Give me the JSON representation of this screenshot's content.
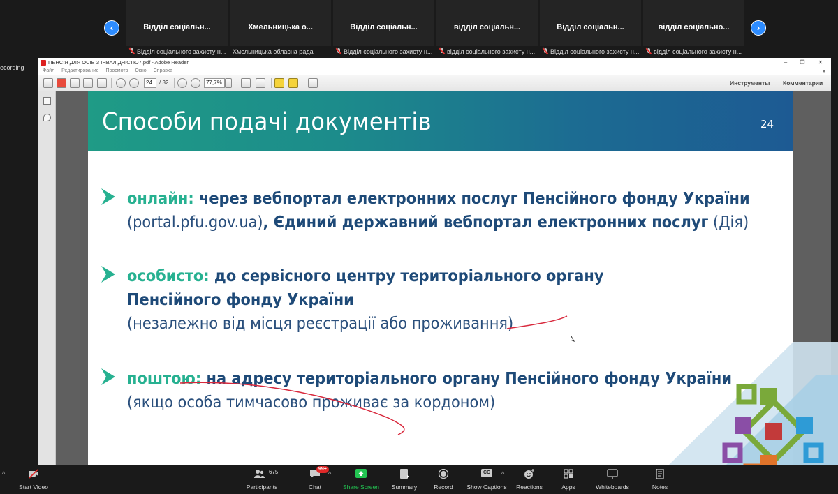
{
  "meeting": {
    "recording_label": "ecording",
    "participant_tiles": [
      {
        "name": "Відділ соціальн...",
        "label": "Відділ соціального захисту н...",
        "muted": true
      },
      {
        "name": "Хмельницька о...",
        "label": "Хмельницька обласна рада",
        "muted": false
      },
      {
        "name": "Відділ соціальн...",
        "label": "Відділ соціального захисту н...",
        "muted": true
      },
      {
        "name": "відділ соціальн...",
        "label": "відділ соціального захисту н...",
        "muted": true
      },
      {
        "name": "Відділ соціальн...",
        "label": "Відділ соціального захисту н...",
        "muted": true
      },
      {
        "name": "відділ соціально...",
        "label": "відділ соціального захисту н...",
        "muted": true
      }
    ],
    "prev_arrow": "‹",
    "next_arrow": "›"
  },
  "reader": {
    "window_title": "ПЕНСІЯ ДЛЯ ОСІБ З ІНВАЛІДНІСТЮ7.pdf - Adobe Reader",
    "window_buttons": {
      "minimize": "–",
      "restore": "❐",
      "close": "✕",
      "menu_close": "×"
    },
    "menu": [
      "Файл",
      "Редактирование",
      "Просмотр",
      "Окно",
      "Справка"
    ],
    "page_current": "24",
    "page_total": "/ 32",
    "zoom": "77,7%",
    "tools_label": "Инструменты",
    "comments_label": "Комментарии"
  },
  "slide": {
    "title": "Способи подачі документів",
    "page_number": "24",
    "bullets": [
      {
        "keyword": "онлайн:",
        "line1": " через вебпортал електронних послуг Пенсійного фонду України",
        "line2_light_a": "(portal.pfu.gov.ua)",
        "line2_bold": ", Єдиний державний вебпортал електронних послуг",
        "line2_light_b": " (Дія)"
      },
      {
        "keyword": "особисто:",
        "line1": " до сервісного центру територіального органу",
        "line2": "Пенсійного фонду України",
        "line3": "(незалежно від місця реєстрації або проживання)"
      },
      {
        "keyword": "поштою:",
        "line1": " на адресу територіального органу Пенсійного фонду України",
        "line2": "(якщо особа тимчасово проживає за кордоном)"
      }
    ]
  },
  "zoom_toolbar": {
    "start_video": "Start Video",
    "participants": "Participants",
    "participants_count": "675",
    "chat": "Chat",
    "chat_badge": "99+",
    "share_screen": "Share Screen",
    "summary": "Summary",
    "record": "Record",
    "show_captions": "Show Captions",
    "captions_icon": "CC",
    "reactions": "Reactions",
    "apps": "Apps",
    "whiteboards": "Whiteboards",
    "notes": "Notes",
    "caret": "^"
  },
  "colors": {
    "zoom_blue": "#2d8cff",
    "slide_keyword": "#27b191",
    "slide_text": "#1e4a78",
    "ink_red": "#d8283c",
    "share_green": "#23c552"
  }
}
